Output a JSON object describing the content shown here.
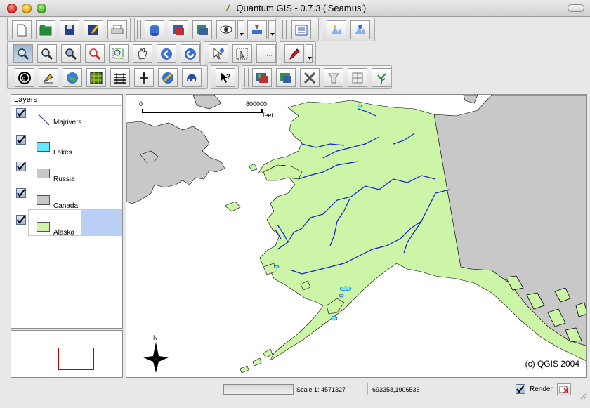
{
  "window": {
    "title": "Quantum GIS - 0.7.3 ('Seamus')"
  },
  "legend": {
    "header": "Layers",
    "layers": [
      {
        "name": "Majrivers",
        "checked": true,
        "kind": "line",
        "color": "#2233aa"
      },
      {
        "name": "Lakes",
        "checked": true,
        "kind": "fill",
        "color": "#5fe8ff"
      },
      {
        "name": "Russia",
        "checked": true,
        "kind": "fill",
        "color": "#c8c8c8"
      },
      {
        "name": "Canada",
        "checked": true,
        "kind": "fill",
        "color": "#c8c8c8"
      },
      {
        "name": "Alaska",
        "checked": true,
        "kind": "fill",
        "color": "#ccf5a8",
        "selected": true
      }
    ]
  },
  "map": {
    "scalebar": {
      "start": "0",
      "end": "800000",
      "unit": "feet"
    },
    "copyright": "(c) QGIS 2004",
    "north_label": "N",
    "colors": {
      "alaska": "#ccf5a8",
      "neighbors": "#c8c8c8",
      "rivers": "#1020d0",
      "lakes": "#5fe8ff"
    }
  },
  "status": {
    "scale": "Scale 1: 4571327",
    "coordinates": "-693358,1906536",
    "render_label": "Render",
    "render_checked": true
  },
  "toolbar": {
    "row1": [
      "new-project-icon",
      "open-project-icon",
      "save-project-icon",
      "save-as-icon",
      "print-icon",
      "add-vector-layer-icon",
      "add-raster-layer-icon",
      "add-postgis-layer-icon",
      "show-all-layers-icon",
      "plugin-dropdown-icon",
      "attribute-table-icon",
      "gps-icon",
      "grass-icon"
    ],
    "row2": [
      "zoom-in-icon",
      "zoom-out-icon",
      "zoom-full-icon",
      "zoom-to-selection-icon",
      "zoom-to-layer-icon",
      "pan-icon",
      "zoom-last-icon",
      "refresh-icon",
      "identify-icon",
      "select-icon",
      "measure-icon",
      "capture-icon"
    ],
    "row3": [
      "copyright-icon",
      "scalebar-tool-icon",
      "georeferencer-icon",
      "graticule-icon",
      "delimited-text-icon",
      "north-arrow-tool-icon",
      "spit-icon",
      "postgis-icon",
      "whats-this-icon",
      "grass-region-icon",
      "grass-tools-icon",
      "grass-edit-icon",
      "grass-new-icon",
      "grass-sel-icon",
      "grass-plant-icon"
    ]
  }
}
